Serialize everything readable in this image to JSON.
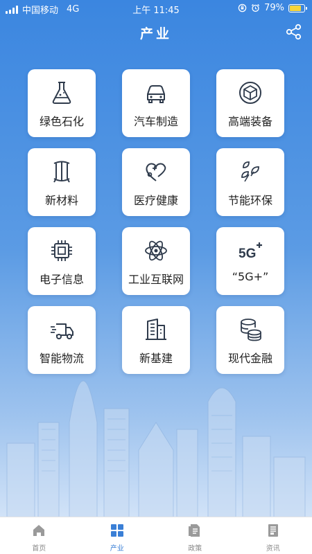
{
  "status_bar": {
    "carrier": "中国移动",
    "network": "4G",
    "time": "上午 11:45",
    "battery": "79%",
    "battery_level": 0.79
  },
  "header": {
    "title": "产业",
    "share_icon": "share-icon"
  },
  "industries": [
    {
      "label": "绿色石化",
      "icon": "flask-icon"
    },
    {
      "label": "汽车制造",
      "icon": "car-icon"
    },
    {
      "label": "高端装备",
      "icon": "cube-icon"
    },
    {
      "label": "新材料",
      "icon": "material-icon"
    },
    {
      "label": "医疗健康",
      "icon": "health-icon"
    },
    {
      "label": "节能环保",
      "icon": "leaf-icon"
    },
    {
      "label": "电子信息",
      "icon": "chip-icon"
    },
    {
      "label": "工业互联网",
      "icon": "atom-icon"
    },
    {
      "label": "“5G+”",
      "icon": "5g-icon"
    },
    {
      "label": "智能物流",
      "icon": "truck-icon"
    },
    {
      "label": "新基建",
      "icon": "building-icon"
    },
    {
      "label": "现代金融",
      "icon": "coins-icon"
    }
  ],
  "tabs": [
    {
      "label": "首页",
      "icon": "home-icon",
      "active": false
    },
    {
      "label": "产业",
      "icon": "grid-icon",
      "active": true
    },
    {
      "label": "政策",
      "icon": "document-icon",
      "active": false
    },
    {
      "label": "资讯",
      "icon": "news-icon",
      "active": false
    }
  ],
  "colors": {
    "primary": "#3a7fd6",
    "tile_icon": "#2f3b4c",
    "tab_inactive": "#9a9a9a"
  }
}
